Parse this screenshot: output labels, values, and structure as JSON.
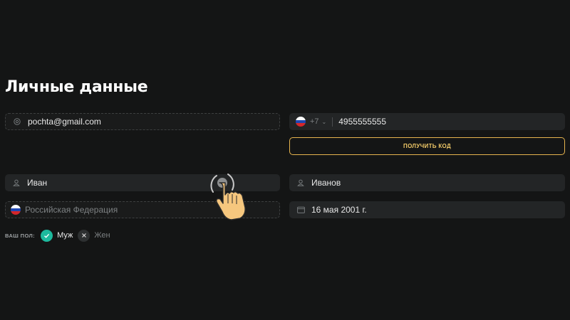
{
  "page": {
    "title": "Личные данные"
  },
  "form": {
    "email": {
      "value": "pochta@gmail.com",
      "icon": "at-icon"
    },
    "phone": {
      "country_code": "+7",
      "value": "4955555555",
      "flag": "russia-flag-icon"
    },
    "get_code_button": "ПОЛУЧИТЬ КОД",
    "first_name": {
      "value": "Иван",
      "icon": "user-icon"
    },
    "last_name": {
      "value": "Иванов",
      "icon": "user-icon"
    },
    "country": {
      "placeholder": "Российская Федерация",
      "flag": "russia-flag-icon"
    },
    "birthdate": {
      "value": "16 мая 2001 г.",
      "icon": "calendar-icon"
    }
  },
  "gender": {
    "label": "ВАШ ПОЛ:",
    "options": [
      {
        "label": "Муж",
        "selected": true,
        "icon": "check-icon"
      },
      {
        "label": "Жен",
        "selected": false,
        "icon": "close-icon"
      }
    ]
  },
  "colors": {
    "background": "#141515",
    "field": "#232526",
    "accent": "#e6b44e",
    "selected": "#1db99d"
  }
}
